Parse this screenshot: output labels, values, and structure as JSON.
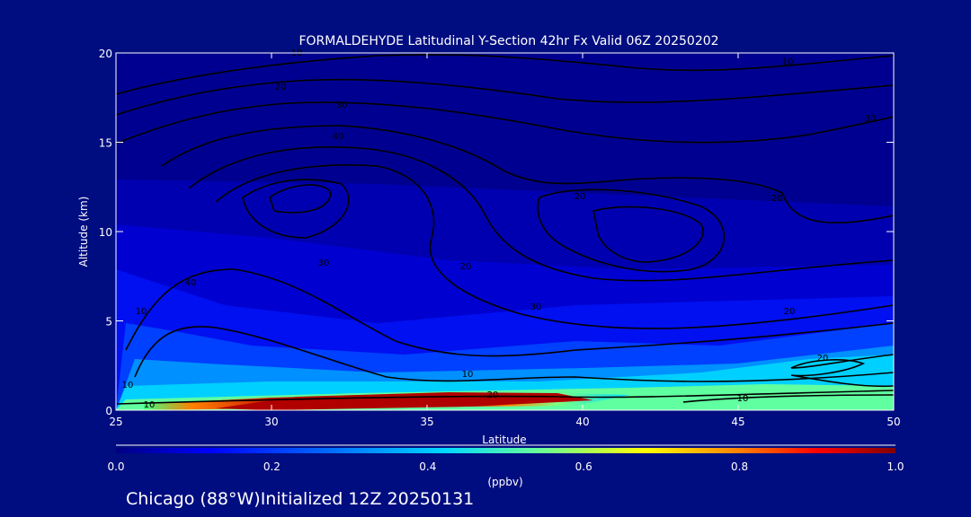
{
  "chart_data": {
    "type": "heatmap",
    "title": "FORMALDEHYDE Latitudinal Y-Section 42hr  Fx Valid 06Z 20250202",
    "xlabel": "Latitude",
    "ylabel": "Altitude (km)",
    "xlim": [
      25,
      50
    ],
    "ylim": [
      0,
      20
    ],
    "xticks": [
      "25",
      "30",
      "35",
      "40",
      "45",
      "50"
    ],
    "yticks": [
      "0",
      "5",
      "10",
      "15",
      "20"
    ],
    "colorbar": {
      "unit": "(ppbv)",
      "range": [
        0.0,
        1.0
      ],
      "ticks": [
        "0.0",
        "0.2",
        "0.4",
        "0.6",
        "0.8",
        "1.0"
      ],
      "colormap": [
        "#000080",
        "#0000ff",
        "#0080ff",
        "#00e0ff",
        "#80ff80",
        "#ffff00",
        "#ff8000",
        "#ff0000",
        "#800000"
      ]
    },
    "contour_labels": [
      "10",
      "20",
      "30",
      "40",
      "20",
      "30",
      "40",
      "20",
      "10",
      "30",
      "20",
      "10",
      "20",
      "30",
      "20",
      "20",
      "10",
      "10",
      "10",
      "10"
    ],
    "footer": "Chicago (88°W)Initialized 12Z 20250131"
  }
}
